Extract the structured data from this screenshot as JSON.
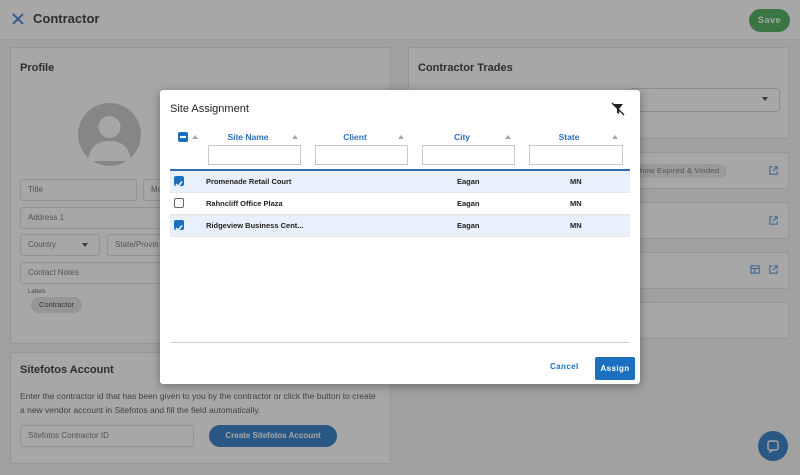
{
  "header": {
    "title": "Contractor",
    "save_label": "Save"
  },
  "profile": {
    "title": "Profile",
    "fields": {
      "title_placeholder": "Title",
      "mobile_placeholder": "Mo",
      "address_placeholder": "Address 1",
      "country_placeholder": "Country",
      "state_placeholder": "State/Provin",
      "notes_placeholder": "Contact Notes"
    },
    "labels_caption": "Labels",
    "labels_chip": "Contractor"
  },
  "sitefotos": {
    "title": "Sitefotos Account",
    "description": "Enter the contractor id that has been given to you by the contractor or click the button to create a new vendor account in Sitefotos and fill the field automatically.",
    "id_placeholder": "Sitefotos Contractor ID",
    "create_label": "Create Sitefotos Account"
  },
  "trades": {
    "title": "Contractor Trades",
    "show_expired": "how Expired & Voided"
  },
  "modal": {
    "title": "Site Assignment",
    "columns": [
      "Site Name",
      "Client",
      "City",
      "State"
    ],
    "rows": [
      {
        "site": "Promenade Retail Court",
        "client": "",
        "city": "Eagan",
        "state": "MN",
        "checked": true
      },
      {
        "site": "Rahncliff Office Plaza",
        "client": "",
        "city": "Eagan",
        "state": "MN",
        "checked": false
      },
      {
        "site": "Ridgeview Business Cent...",
        "client": "",
        "city": "Eagan",
        "state": "MN",
        "checked": true
      }
    ],
    "cancel_label": "Cancel",
    "assign_label": "Assign"
  },
  "colors": {
    "accent": "#1a6fbf",
    "save": "#37a64a",
    "overlay": "#3c3c3c"
  }
}
